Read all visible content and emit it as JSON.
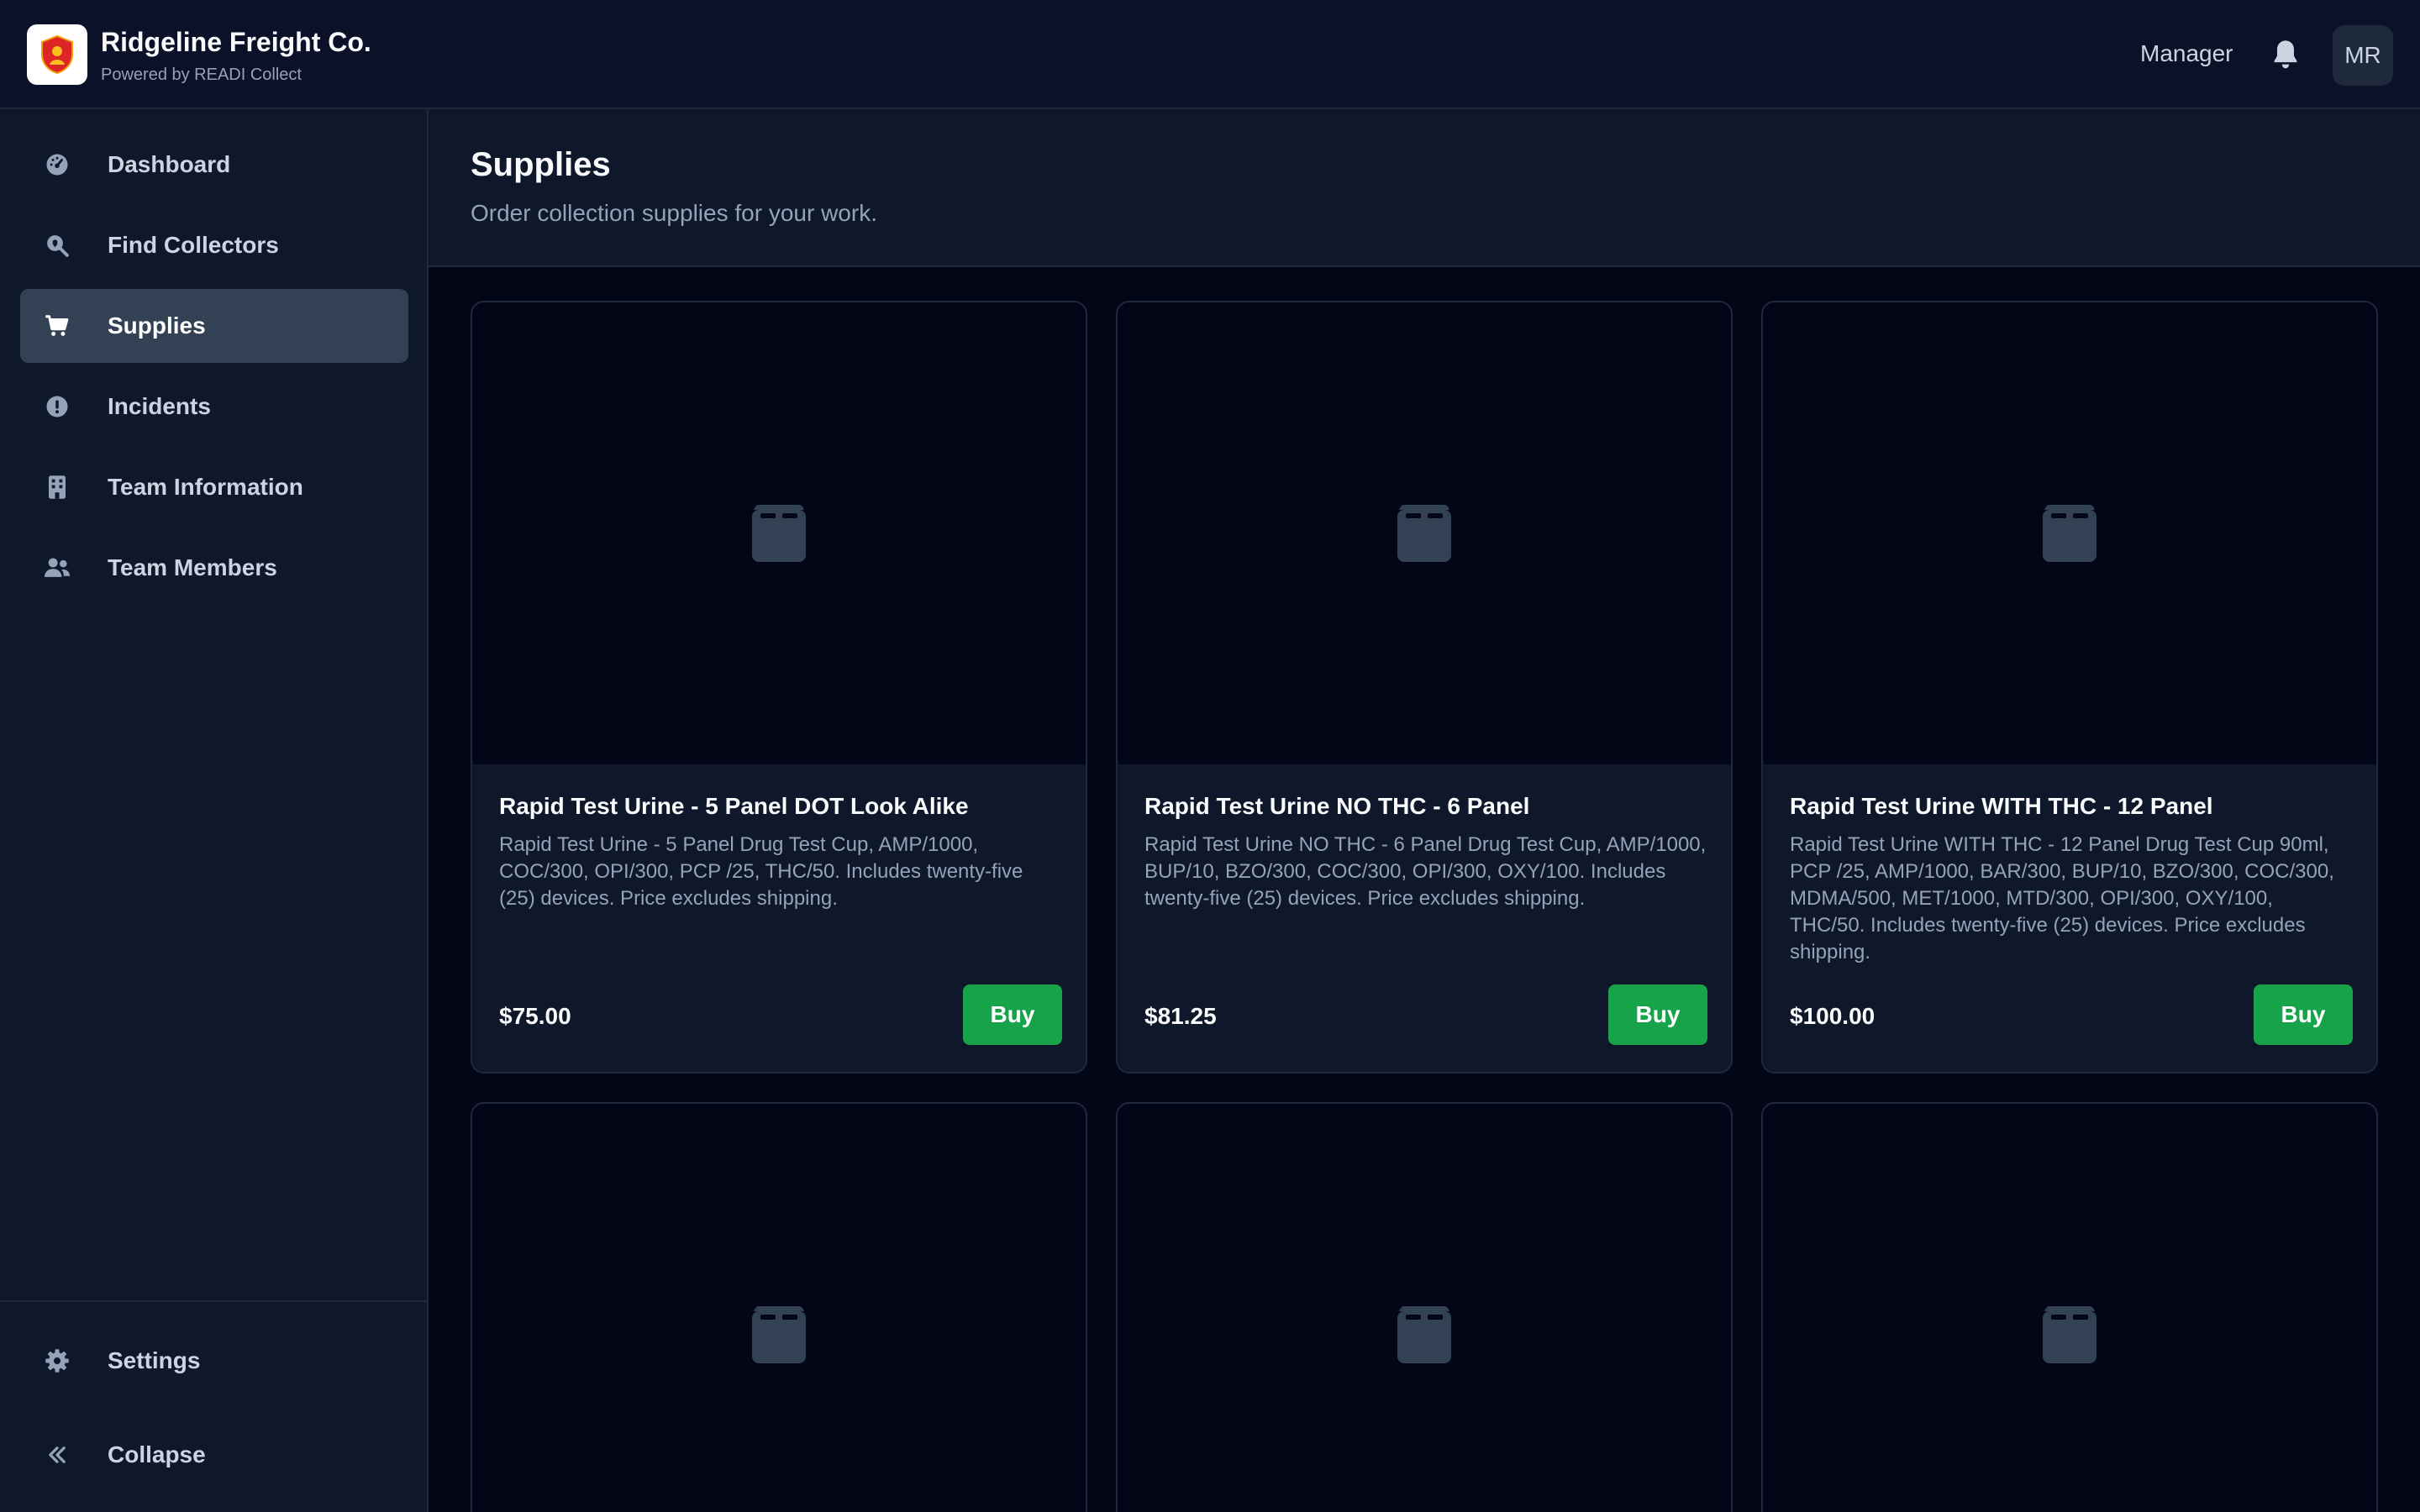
{
  "header": {
    "brand_name": "Ridgeline Freight Co.",
    "brand_sub": "Powered by READI Collect",
    "role": "Manager",
    "avatar_initials": "MR"
  },
  "sidebar": {
    "items": [
      {
        "label": "Dashboard",
        "icon": "dashboard-gauge-icon",
        "active": false
      },
      {
        "label": "Find Collectors",
        "icon": "search-location-icon",
        "active": false
      },
      {
        "label": "Supplies",
        "icon": "cart-icon",
        "active": true
      },
      {
        "label": "Incidents",
        "icon": "alert-circle-icon",
        "active": false
      },
      {
        "label": "Team Information",
        "icon": "building-icon",
        "active": false
      },
      {
        "label": "Team Members",
        "icon": "users-icon",
        "active": false
      }
    ],
    "settings_label": "Settings",
    "collapse_label": "Collapse"
  },
  "page": {
    "title": "Supplies",
    "subtitle": "Order collection supplies for your work."
  },
  "products": [
    {
      "title": "Rapid Test Urine - 5 Panel DOT Look Alike",
      "description": "Rapid Test Urine - 5 Panel Drug Test Cup, AMP/1000, COC/300, OPI/300, PCP /25, THC/50. Includes twenty-five (25) devices. Price excludes shipping.",
      "price": "$75.00",
      "button": "Buy"
    },
    {
      "title": "Rapid Test Urine NO THC - 6 Panel",
      "description": "Rapid Test Urine NO THC - 6 Panel Drug Test Cup, AMP/1000, BUP/10, BZO/300, COC/300, OPI/300, OXY/100. Includes twenty-five (25) devices. Price excludes shipping.",
      "price": "$81.25",
      "button": "Buy"
    },
    {
      "title": "Rapid Test Urine WITH THC - 12 Panel",
      "description": "Rapid Test Urine WITH THC - 12 Panel Drug Test Cup 90ml, PCP /25, AMP/1000, BAR/300, BUP/10, BZO/300, COC/300, MDMA/500, MET/1000, MTD/300, OPI/300, OXY/100, THC/50. Includes twenty-five (25) devices. Price excludes shipping.",
      "price": "$100.00",
      "button": "Buy"
    }
  ],
  "colors": {
    "accent_green": "#16a34a",
    "active_nav": "#334155",
    "background": "#020617"
  }
}
